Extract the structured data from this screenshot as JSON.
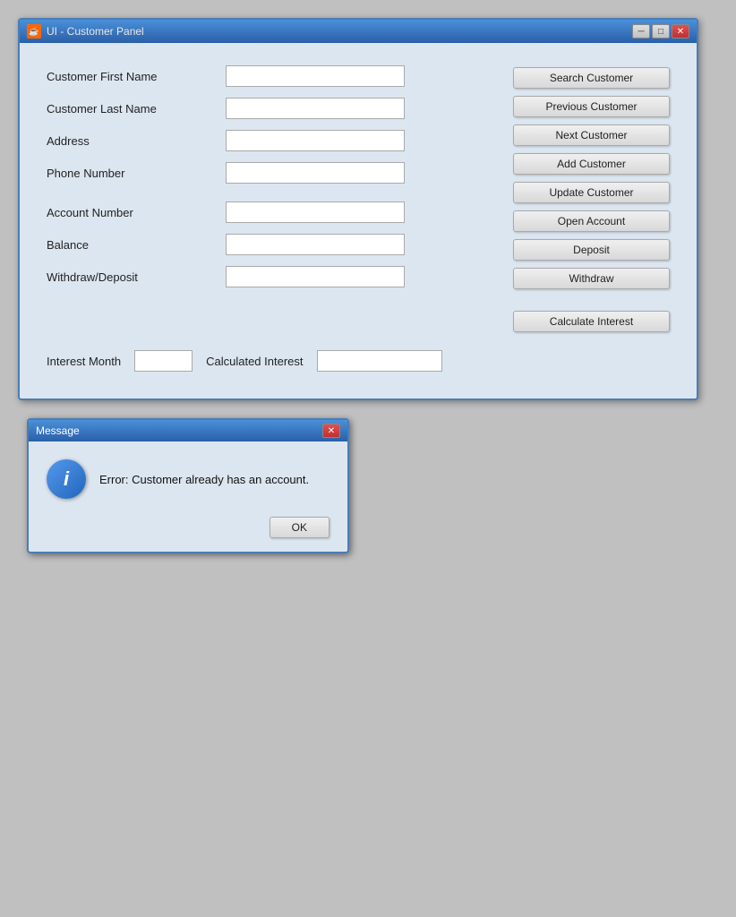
{
  "mainWindow": {
    "title": "UI - Customer Panel",
    "labels": {
      "firstName": "Customer First Name",
      "lastName": "Customer Last Name",
      "address": "Address",
      "phoneNumber": "Phone Number",
      "accountNumber": "Account Number",
      "balance": "Balance",
      "withdrawDeposit": "Withdraw/Deposit",
      "interestMonth": "Interest Month",
      "calculatedInterest": "Calculated Interest"
    },
    "buttons": {
      "searchCustomer": "Search Customer",
      "previousCustomer": "Previous Customer",
      "nextCustomer": "Next Customer",
      "addCustomer": "Add Customer",
      "updateCustomer": "Update Customer",
      "openAccount": "Open Account",
      "deposit": "Deposit",
      "withdraw": "Withdraw",
      "calculateInterest": "Calculate Interest",
      "ok": "OK"
    },
    "inputs": {
      "firstName": "",
      "lastName": "",
      "address": "",
      "phoneNumber": "",
      "accountNumber": "",
      "balance": "",
      "withdrawDeposit": "",
      "interestMonth": "",
      "calculatedInterest": ""
    }
  },
  "messageDialog": {
    "title": "Message",
    "message": "Error: Customer already has an account.",
    "iconLabel": "i"
  },
  "icons": {
    "java": "☕",
    "minimize": "─",
    "maximize": "□",
    "close": "✕"
  }
}
